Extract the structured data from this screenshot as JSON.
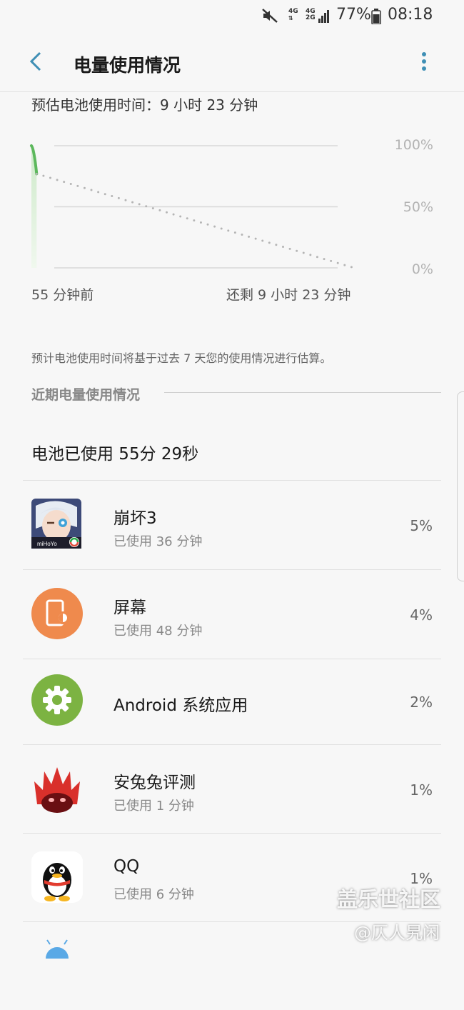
{
  "status_bar": {
    "net1_top": "4G",
    "net2_top": "4G",
    "net2_bottom": "2G",
    "battery_pct": "77%",
    "time": "08:18"
  },
  "header": {
    "title": "电量使用情况"
  },
  "estimate": "预估电池使用时间：9 小时 23 分钟",
  "chart": {
    "y_labels": [
      "100%",
      "50%",
      "0%"
    ],
    "x_start": "55 分钟前",
    "x_end": "还剩 9 小时 23 分钟",
    "accent": "#5cb85c"
  },
  "chart_data": {
    "type": "line",
    "xlabel": "",
    "ylabel": "",
    "ylim": [
      0,
      100
    ],
    "yticks": [
      "100%",
      "50%",
      "0%"
    ],
    "x_labels": [
      "55 分钟前",
      "还剩 9 小时 23 分钟"
    ],
    "series": [
      {
        "style": "solid",
        "x": [
          -55,
          -45
        ],
        "values": [
          100,
          77
        ]
      },
      {
        "style": "dotted",
        "x": [
          -45,
          563
        ],
        "values": [
          77,
          0
        ]
      }
    ],
    "grid": true
  },
  "note": "预计电池使用时间将基于过去 7 天您的使用情况进行估算。",
  "section_title": "近期电量使用情况",
  "battery_used": "电池已使用 55分 29秒",
  "apps": [
    {
      "name": "崩坏3",
      "sub": "已使用 36 分钟",
      "pct": "5%",
      "icon": "honkai-impact-icon"
    },
    {
      "name": "屏幕",
      "sub": "已使用 48 分钟",
      "pct": "4%",
      "icon": "screen-icon"
    },
    {
      "name": "Android 系统应用",
      "sub": "",
      "pct": "2%",
      "icon": "android-system-icon"
    },
    {
      "name": "安兔兔评测",
      "sub": "已使用 1 分钟",
      "pct": "1%",
      "icon": "antutu-icon"
    },
    {
      "name": "QQ",
      "sub": "已使用 6 分钟",
      "pct": "1%",
      "icon": "qq-icon"
    }
  ],
  "watermark": {
    "line1": "盖乐世社区",
    "line2": "@仄人旯闲"
  }
}
